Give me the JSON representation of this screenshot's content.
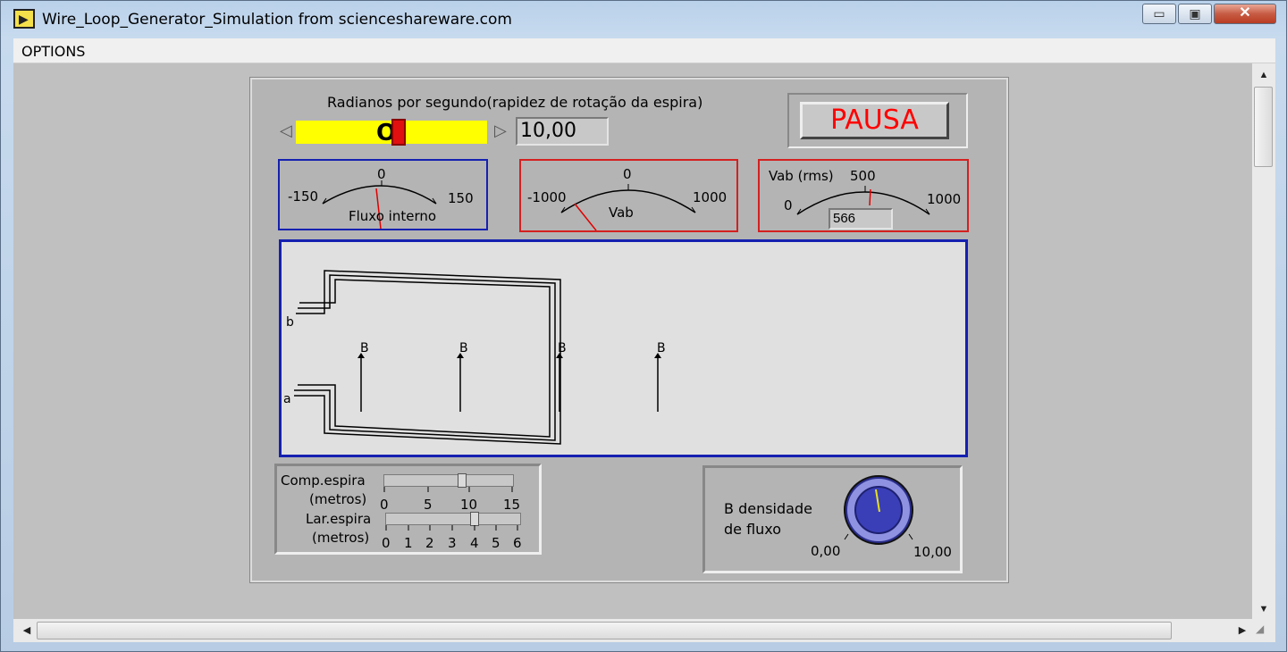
{
  "window": {
    "title": "Wire_Loop_Generator_Simulation from scienceshareware.com",
    "minimize_glyph": "▭",
    "maximize_glyph": "▣",
    "close_glyph": "✕"
  },
  "menu": {
    "options_label": "OPTIONS"
  },
  "speed": {
    "label": "Radianos por segundo(rapidez de rotação da espira)",
    "knob_glyph": "O",
    "value": "10,00",
    "left_arrow": "◁",
    "right_arrow": "▷"
  },
  "pause_button": {
    "label": "PAUSA",
    "color": "#ff0000"
  },
  "meters": {
    "flux": {
      "label": "Fluxo interno",
      "min": "-150",
      "mid": "0",
      "max": "150",
      "border_color": "#1520b0"
    },
    "vab": {
      "label": "Vab",
      "min": "-1000",
      "mid": "0",
      "max": "1000",
      "border_color": "#d42020"
    },
    "vab_rms": {
      "label": "Vab (rms)",
      "min": "0",
      "mid": "500",
      "max": "1000",
      "value": "566",
      "border_color": "#d42020"
    }
  },
  "scene": {
    "terminal_b": "b",
    "terminal_a": "a",
    "field_label": "B"
  },
  "dimensions": {
    "length_label_1": "Comp.espira",
    "length_label_2": "(metros)",
    "length_ticks": [
      "0",
      "5",
      "10",
      "15"
    ],
    "width_label_1": "Lar.espira",
    "width_label_2": "(metros)",
    "width_ticks": [
      "0",
      "1",
      "2",
      "3",
      "4",
      "5",
      "6"
    ]
  },
  "flux_density": {
    "label_line1": "B densidade",
    "label_line2": "de fluxo",
    "min": "0,00",
    "max": "10,00",
    "knob_color": "#3a3fb8"
  },
  "scrollbars": {
    "up": "▲",
    "down": "▼",
    "left": "◀",
    "right": "▶",
    "grip": "◢"
  }
}
